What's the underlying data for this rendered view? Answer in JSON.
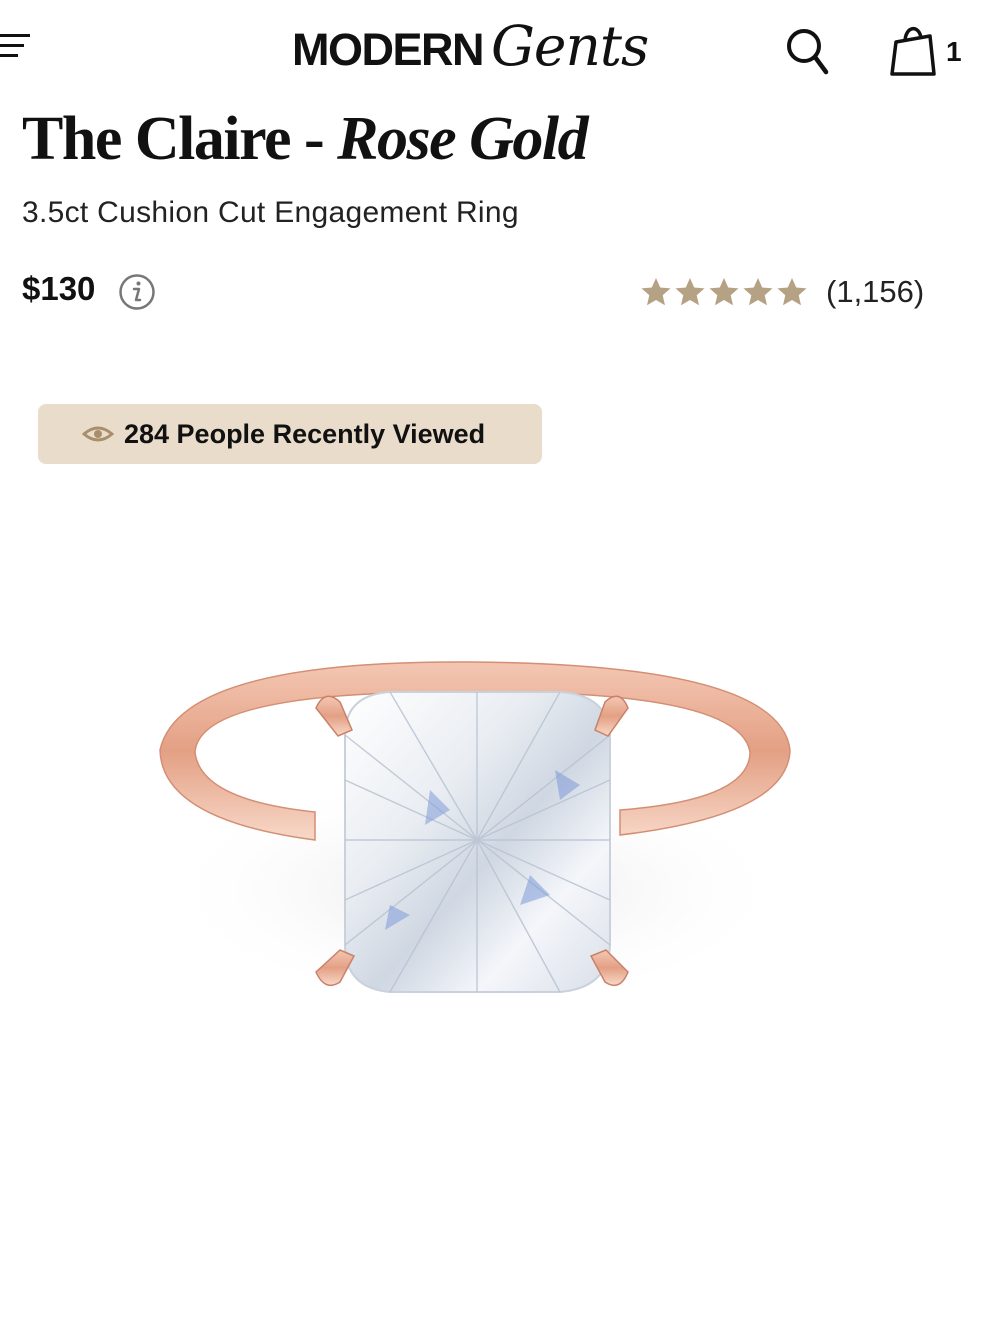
{
  "header": {
    "logo_main": "MODERN",
    "logo_script": "Gents",
    "cart_count": "1",
    "menu_icon": "hamburger-menu-icon",
    "search_icon": "search-icon",
    "cart_icon": "shopping-bag-icon"
  },
  "product": {
    "name": "The Claire - ",
    "variant": "Rose Gold",
    "subtitle": "3.5ct Cushion Cut Engagement Ring",
    "price": "$130",
    "rating_stars": 5,
    "review_count": "(1,156)",
    "image_alt_icon": "engagement-ring-image"
  },
  "badge": {
    "text": "284 People Recently Viewed",
    "icon": "eye-icon"
  },
  "colors": {
    "star": "#b5a183",
    "badge_bg": "#e9dccb",
    "rose_gold": "#e8a98d",
    "text": "#111111"
  }
}
